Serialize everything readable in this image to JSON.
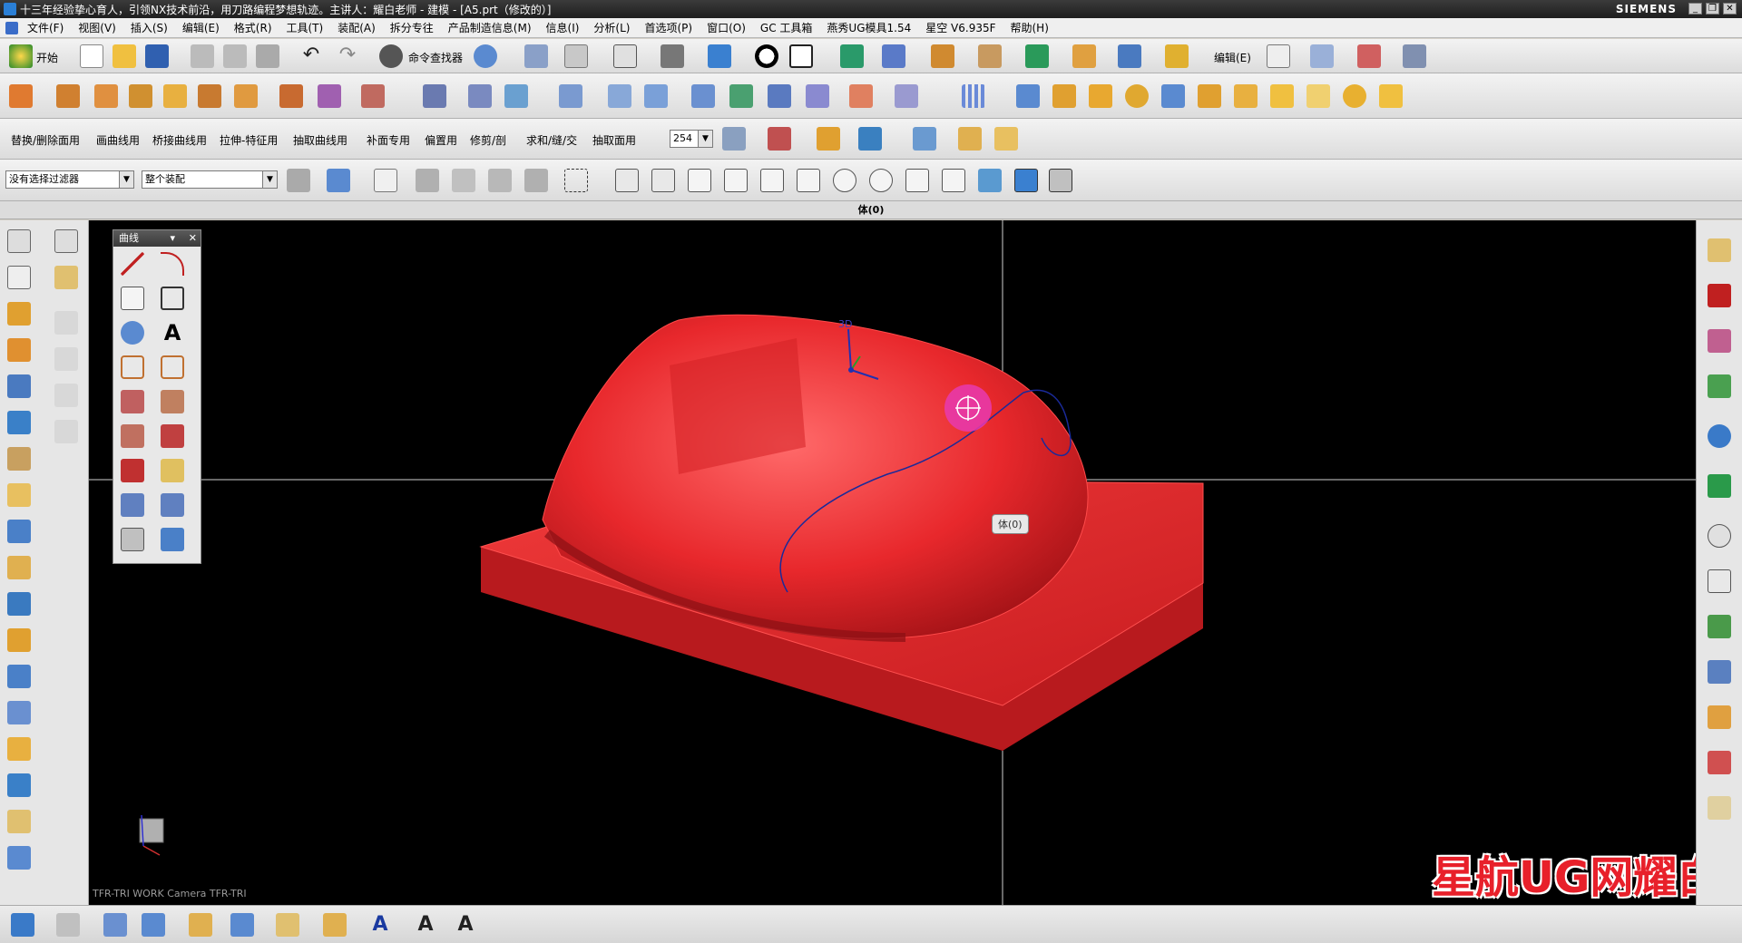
{
  "title": {
    "text": "十三年经验挚心育人，引领NX技术前沿，用刀路编程梦想轨迹。主讲人：耀白老师 - 建模 - [A5.prt（修改的）]",
    "brand": "SIEMENS"
  },
  "menu": [
    "文件(F)",
    "视图(V)",
    "插入(S)",
    "编辑(E)",
    "格式(R)",
    "工具(T)",
    "装配(A)",
    "拆分专往",
    "产品制造信息(M)",
    "信息(I)",
    "分析(L)",
    "首选项(P)",
    "窗口(O)",
    "GC 工具箱",
    "燕秀UG模具1.54",
    "星空 V6.935F",
    "帮助(H)"
  ],
  "toolbar1": {
    "start_label": "开始",
    "cmd_finder_label": "命令查找器",
    "edit_label": "编辑(E)"
  },
  "toolbar3": {
    "groups": [
      "替换/删除面用",
      "画曲线用",
      "桥接曲线用",
      "拉伸-特征用",
      "抽取曲线用",
      "补面专用",
      "偏置用",
      "修剪/剖",
      "求和/缝/交",
      "抽取面用"
    ],
    "layer_value": "254"
  },
  "selbar": {
    "filter_value": "没有选择过滤器",
    "scope_value": "整个装配"
  },
  "viewbar": {
    "label": "体(0)"
  },
  "curve_palette": {
    "title": "曲线"
  },
  "viewport": {
    "tooltip": "体(0)",
    "camera_label": "TFR-TRI WORK Camera TFR-TRI",
    "wcs_label": "3D"
  },
  "watermark": "星航UG网耀白老师",
  "colors": {
    "model": "#e8282c",
    "background": "#000000",
    "curve": "#1a2a9a",
    "cursor_halo": "#e83ab0"
  }
}
